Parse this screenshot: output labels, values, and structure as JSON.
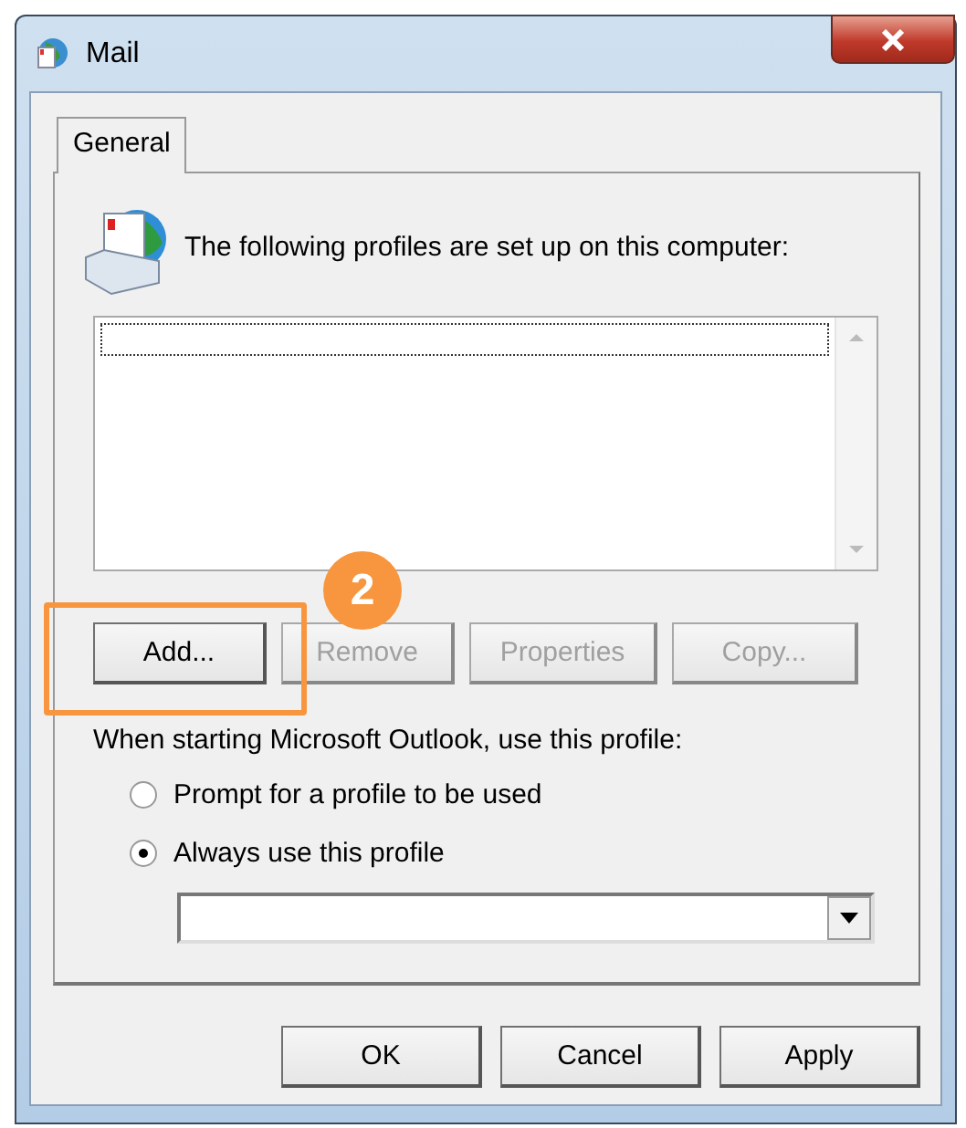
{
  "window": {
    "title": "Mail"
  },
  "tabs": [
    {
      "label": "General",
      "selected": true
    }
  ],
  "header": {
    "text": "The following profiles are set up on this computer:"
  },
  "profiles": {
    "items": [
      {
        "selected": true
      }
    ]
  },
  "profile_buttons": [
    {
      "label": "Add...",
      "disabled": false
    },
    {
      "label": "Remove",
      "disabled": true
    },
    {
      "label": "Properties",
      "disabled": true
    },
    {
      "label": "Copy...",
      "disabled": true
    }
  ],
  "startup": {
    "label": "When starting Microsoft Outlook, use this profile:",
    "options": [
      {
        "label": "Prompt for a profile to be used",
        "selected": false
      },
      {
        "label": "Always use this profile",
        "selected": true
      }
    ]
  },
  "callout": {
    "number": "2"
  },
  "buttons": [
    {
      "label": "OK"
    },
    {
      "label": "Cancel"
    },
    {
      "label": "Apply"
    }
  ]
}
